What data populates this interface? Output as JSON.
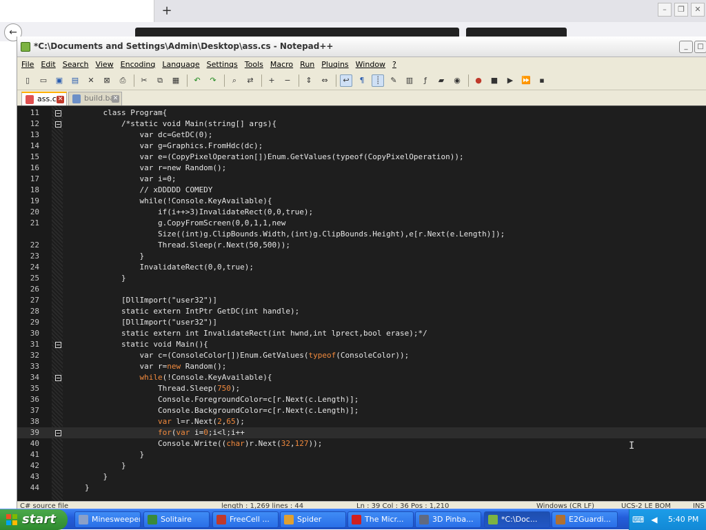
{
  "window": {
    "title": "*C:\\Documents and Settings\\Admin\\Desktop\\ass.cs - Notepad++"
  },
  "menu": [
    "File",
    "Edit",
    "Search",
    "View",
    "Encoding",
    "Language",
    "Settings",
    "Tools",
    "Macro",
    "Run",
    "Plugins",
    "Window",
    "?"
  ],
  "toolbar_icons": [
    "new-file-icon",
    "open-file-icon",
    "save-icon",
    "save-all-icon",
    "close-icon",
    "close-all-icon",
    "print-icon",
    "cut-icon",
    "copy-icon",
    "paste-icon",
    "undo-icon",
    "redo-icon",
    "find-icon",
    "replace-icon",
    "zoom-in-icon",
    "zoom-out-icon",
    "sync-vertical-icon",
    "sync-horizontal-icon",
    "word-wrap-icon",
    "show-all-chars-icon",
    "indent-guide-icon",
    "user-lang-icon",
    "doc-map-icon",
    "function-list-icon",
    "folder-workspace-icon",
    "monitor-icon",
    "record-macro-icon",
    "stop-macro-icon",
    "play-macro-icon",
    "run-macro-multiple-icon",
    "save-macro-icon"
  ],
  "tabs": [
    {
      "label": "ass.cs",
      "active": true
    },
    {
      "label": "build.bat",
      "active": false
    }
  ],
  "code_lines": [
    {
      "n": "11",
      "fold": true,
      "segs": [
        [
          "    class Program{",
          ""
        ]
      ]
    },
    {
      "n": "12",
      "fold": true,
      "segs": [
        [
          "        /*static void Main(string[] args){",
          "cm"
        ]
      ]
    },
    {
      "n": "13",
      "segs": [
        [
          "            var dc=GetDC(0);",
          "cm"
        ]
      ]
    },
    {
      "n": "14",
      "segs": [
        [
          "            var g=Graphics.FromHdc(dc);",
          "cm"
        ]
      ]
    },
    {
      "n": "15",
      "segs": [
        [
          "            var e=(CopyPixelOperation[])Enum.GetValues(typeof(CopyPixelOperation));",
          "cm"
        ]
      ]
    },
    {
      "n": "16",
      "segs": [
        [
          "            var r=new Random();",
          "cm"
        ]
      ]
    },
    {
      "n": "17",
      "segs": [
        [
          "            var i=0;",
          "cm"
        ]
      ]
    },
    {
      "n": "18",
      "segs": [
        [
          "            // xDDDDD COMEDY",
          "cm"
        ]
      ]
    },
    {
      "n": "19",
      "segs": [
        [
          "            while(!Console.KeyAvailable){",
          "cm"
        ]
      ]
    },
    {
      "n": "20",
      "segs": [
        [
          "                if(i++>3)InvalidateRect(0,0,true);",
          "cm"
        ]
      ]
    },
    {
      "n": "21",
      "segs": [
        [
          "                g.CopyFromScreen(0,0,1,1,new",
          "cm"
        ]
      ]
    },
    {
      "n": "",
      "segs": [
        [
          "                Size((int)g.ClipBounds.Width,(int)g.ClipBounds.Height),e[r.Next(e.Length)]);",
          "cm"
        ]
      ]
    },
    {
      "n": "22",
      "segs": [
        [
          "                Thread.Sleep(r.Next(50,500));",
          "cm"
        ]
      ]
    },
    {
      "n": "23",
      "segs": [
        [
          "            }",
          "cm"
        ]
      ]
    },
    {
      "n": "24",
      "segs": [
        [
          "            InvalidateRect(0,0,true);",
          "cm"
        ]
      ]
    },
    {
      "n": "25",
      "segs": [
        [
          "        }",
          "cm"
        ]
      ]
    },
    {
      "n": "26",
      "segs": [
        [
          "",
          ""
        ]
      ]
    },
    {
      "n": "27",
      "segs": [
        [
          "        [DllImport(\"user32\")]",
          "cm"
        ]
      ]
    },
    {
      "n": "28",
      "segs": [
        [
          "        static extern IntPtr GetDC(int handle);",
          "cm"
        ]
      ]
    },
    {
      "n": "29",
      "segs": [
        [
          "        [DllImport(\"user32\")]",
          "cm"
        ]
      ]
    },
    {
      "n": "30",
      "segs": [
        [
          "        static extern int InvalidateRect(int hwnd,int lprect,bool erase);*/",
          "cm"
        ]
      ]
    },
    {
      "n": "31",
      "fold": true,
      "segs": [
        [
          "        static void Main(){",
          ""
        ]
      ]
    },
    {
      "n": "32",
      "segs": [
        [
          "            var c=(ConsoleColor[])Enum.GetValues(",
          ""
        ],
        [
          "typeof",
          "kw"
        ],
        [
          "(ConsoleColor));",
          ""
        ]
      ]
    },
    {
      "n": "33",
      "segs": [
        [
          "            var r=",
          ""
        ],
        [
          "new",
          "kw"
        ],
        [
          " Random();",
          ""
        ]
      ]
    },
    {
      "n": "34",
      "fold": true,
      "segs": [
        [
          "            ",
          ""
        ],
        [
          "while",
          "kw"
        ],
        [
          "(!Console.KeyAvailable){",
          ""
        ]
      ]
    },
    {
      "n": "35",
      "segs": [
        [
          "                Thread.Sleep(",
          ""
        ],
        [
          "750",
          "num"
        ],
        [
          ");",
          ""
        ]
      ]
    },
    {
      "n": "36",
      "segs": [
        [
          "                Console.ForegroundColor=c[r.Next(c.Length)];",
          ""
        ]
      ]
    },
    {
      "n": "37",
      "segs": [
        [
          "                Console.BackgroundColor=c[r.Next(c.Length)];",
          ""
        ]
      ]
    },
    {
      "n": "38",
      "segs": [
        [
          "                ",
          ""
        ],
        [
          "var",
          "kw"
        ],
        [
          " l=r.Next(",
          ""
        ],
        [
          "2",
          "num"
        ],
        [
          ",",
          ""
        ],
        [
          "65",
          "num"
        ],
        [
          ");",
          ""
        ]
      ]
    },
    {
      "n": "39",
      "fold": true,
      "cur": true,
      "segs": [
        [
          "                ",
          ""
        ],
        [
          "for",
          "kw"
        ],
        [
          "(",
          ""
        ],
        [
          "var",
          "kw"
        ],
        [
          " i=",
          ""
        ],
        [
          "0",
          "num"
        ],
        [
          ";i<l;i++",
          ""
        ]
      ]
    },
    {
      "n": "40",
      "segs": [
        [
          "                Console.Write((",
          ""
        ],
        [
          "char",
          "kw"
        ],
        [
          ")r.Next(",
          ""
        ],
        [
          "32",
          "num"
        ],
        [
          ",",
          ""
        ],
        [
          "127",
          "num"
        ],
        [
          "));",
          ""
        ]
      ]
    },
    {
      "n": "41",
      "segs": [
        [
          "            }",
          ""
        ]
      ]
    },
    {
      "n": "42",
      "segs": [
        [
          "        }",
          ""
        ]
      ]
    },
    {
      "n": "43",
      "segs": [
        [
          "    }",
          ""
        ]
      ]
    },
    {
      "n": "44",
      "segs": [
        [
          "}",
          ""
        ]
      ]
    }
  ],
  "status": {
    "type": "C# source file",
    "length": "length : 1,269    lines : 44",
    "pos": "Ln : 39    Col : 36    Pos : 1,210",
    "eol": "Windows (CR LF)",
    "enc": "UCS-2 LE BOM",
    "mode": "INS"
  },
  "taskbar": {
    "start": "start",
    "tasks": [
      {
        "label": "Minesweeper",
        "icon": "minesweeper-icon",
        "color": "#8aa0c8"
      },
      {
        "label": "Solitaire",
        "icon": "solitaire-icon",
        "color": "#3a8a3a"
      },
      {
        "label": "FreeCell ...",
        "icon": "freecell-icon",
        "color": "#c0392b"
      },
      {
        "label": "Spider",
        "icon": "spider-icon",
        "color": "#e0a030"
      },
      {
        "label": "The Micr...",
        "icon": "heart-icon",
        "color": "#d02020"
      },
      {
        "label": "3D Pinba...",
        "icon": "pinball-icon",
        "color": "#606a80"
      },
      {
        "label": "*C:\\Doc...",
        "icon": "notepadpp-icon",
        "color": "#7cb342",
        "active": true
      },
      {
        "label": "E2Guardi...",
        "icon": "e2guardian-icon",
        "color": "#b07030"
      }
    ],
    "clock": "5:40 PM"
  }
}
